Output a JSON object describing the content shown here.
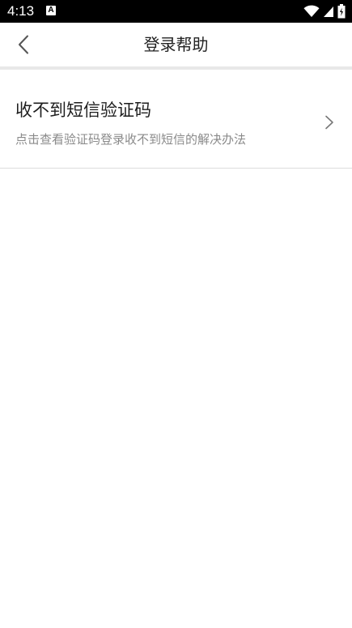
{
  "status_bar": {
    "time": "4:13",
    "notification_icon": "a-notification-icon",
    "icons": [
      "wifi-icon",
      "cell-signal-icon",
      "battery-icon"
    ]
  },
  "header": {
    "title": "登录帮助",
    "back_icon": "chevron-left-icon"
  },
  "help_items": [
    {
      "title": "收不到短信验证码",
      "description": "点击查看验证码登录收不到短信的解决办法",
      "icon": "chevron-right-icon"
    }
  ],
  "colors": {
    "status_bar_bg": "#000000",
    "background": "#ffffff",
    "divider": "#e8e8e8",
    "title_text": "#222222",
    "secondary_text": "#8a8a8a"
  }
}
